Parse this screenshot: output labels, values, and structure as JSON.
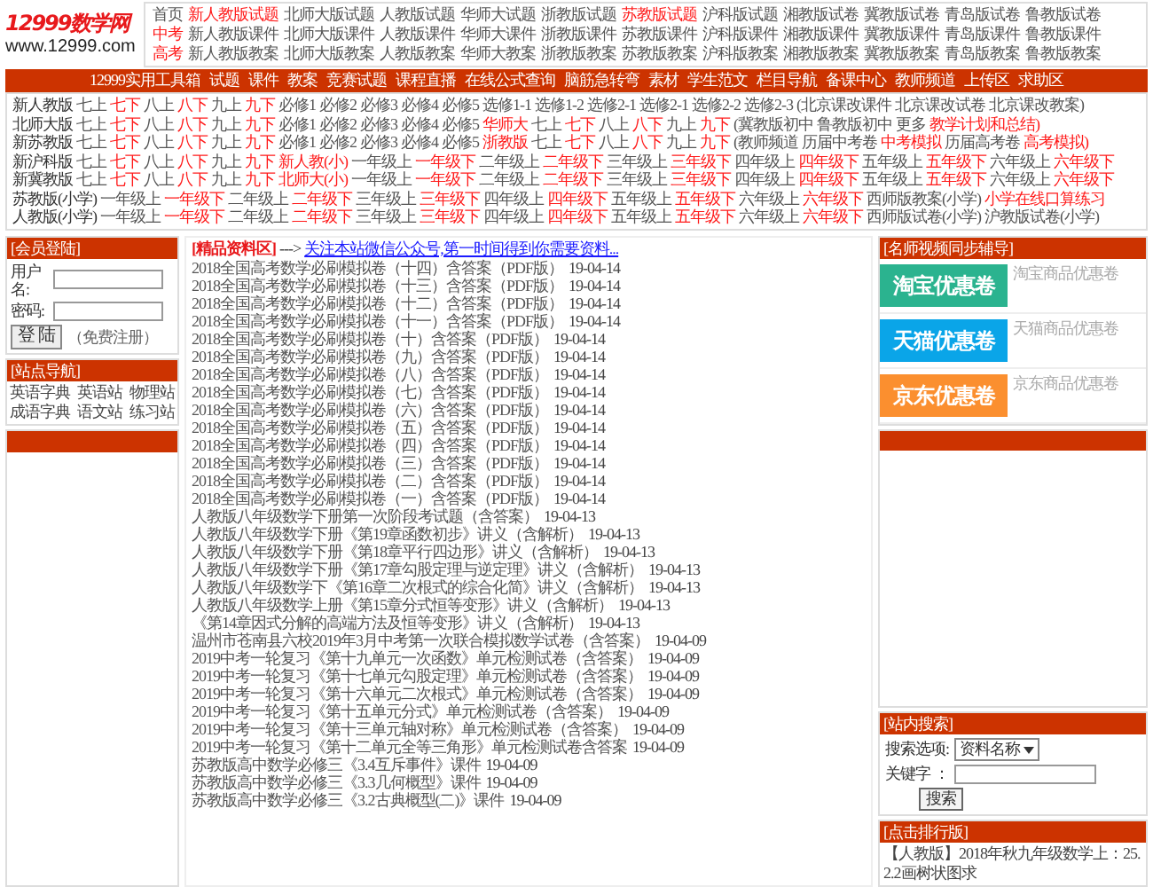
{
  "logo": {
    "name": "12999数学网",
    "url": "www.12999.com"
  },
  "header_rows": [
    [
      {
        "text": "首页",
        "highlight": false
      },
      {
        "text": "新人教版试题",
        "highlight": true
      },
      {
        "text": "北师大版试题",
        "highlight": false
      },
      {
        "text": "人教版试题",
        "highlight": false
      },
      {
        "text": "华师大试题",
        "highlight": false
      },
      {
        "text": "浙教版试题",
        "highlight": false
      },
      {
        "text": "苏教版试题",
        "highlight": true
      },
      {
        "text": "沪科版试题",
        "highlight": false
      },
      {
        "text": "湘教版试卷",
        "highlight": false
      },
      {
        "text": "冀教版试卷",
        "highlight": false
      },
      {
        "text": "青岛版试卷",
        "highlight": false
      },
      {
        "text": "鲁教版试卷",
        "highlight": false
      }
    ],
    [
      {
        "text": "中考",
        "highlight": true
      },
      {
        "text": "新人教版课件",
        "highlight": false
      },
      {
        "text": "北师大版课件",
        "highlight": false
      },
      {
        "text": "人教版课件",
        "highlight": false
      },
      {
        "text": "华师大课件",
        "highlight": false
      },
      {
        "text": "浙教版课件",
        "highlight": false
      },
      {
        "text": "苏教版课件",
        "highlight": false
      },
      {
        "text": "沪科版课件",
        "highlight": false
      },
      {
        "text": "湘教版课件",
        "highlight": false
      },
      {
        "text": "冀教版课件",
        "highlight": false
      },
      {
        "text": "青岛版课件",
        "highlight": false
      },
      {
        "text": "鲁教版课件",
        "highlight": false
      }
    ],
    [
      {
        "text": "高考",
        "highlight": true
      },
      {
        "text": "新人教版教案",
        "highlight": false
      },
      {
        "text": "北师大版教案",
        "highlight": false
      },
      {
        "text": "人教版教案",
        "highlight": false
      },
      {
        "text": "华师大教案",
        "highlight": false
      },
      {
        "text": "浙教版教案",
        "highlight": false
      },
      {
        "text": "苏教版教案",
        "highlight": false
      },
      {
        "text": "沪科版教案",
        "highlight": false
      },
      {
        "text": "湘教版教案",
        "highlight": false
      },
      {
        "text": "冀教版教案",
        "highlight": false
      },
      {
        "text": "青岛版教案",
        "highlight": false
      },
      {
        "text": "鲁教版教案",
        "highlight": false
      }
    ]
  ],
  "nav": [
    "12999实用工具箱",
    "试题",
    "课件",
    "教案",
    "竞赛试题",
    "课程直播",
    "在线公式查询",
    "脑筋急转弯",
    "素材",
    "学生范文",
    "栏目导航",
    "备课中心",
    "教师频道",
    "上传区",
    "求助区"
  ],
  "class_rows": [
    {
      "label": "新人教版",
      "links": [
        {
          "text": "七上",
          "highlight": false
        },
        {
          "text": "七下",
          "highlight": true
        },
        {
          "text": "八上",
          "highlight": false
        },
        {
          "text": "八下",
          "highlight": true
        },
        {
          "text": "九上",
          "highlight": false
        },
        {
          "text": "九下",
          "highlight": true
        },
        {
          "text": "必修1",
          "highlight": false
        },
        {
          "text": "必修2",
          "highlight": false
        },
        {
          "text": "必修3",
          "highlight": false
        },
        {
          "text": "必修4",
          "highlight": false
        },
        {
          "text": "必修5",
          "highlight": false
        },
        {
          "text": "选修1-1",
          "highlight": false
        },
        {
          "text": "选修1-2",
          "highlight": false
        },
        {
          "text": "选修2-1",
          "highlight": false
        },
        {
          "text": "选修2-1",
          "highlight": false
        },
        {
          "text": "选修2-2",
          "highlight": false
        },
        {
          "text": "选修2-3",
          "highlight": false
        },
        {
          "text": "(北京课改课件",
          "highlight": false
        },
        {
          "text": "北京课改试卷",
          "highlight": false
        },
        {
          "text": "北京课改教案)",
          "highlight": false
        }
      ]
    },
    {
      "label": "北师大版",
      "links": [
        {
          "text": "七上",
          "highlight": false
        },
        {
          "text": "七下",
          "highlight": true
        },
        {
          "text": "八上",
          "highlight": false
        },
        {
          "text": "八下",
          "highlight": true
        },
        {
          "text": "九上",
          "highlight": false
        },
        {
          "text": "九下",
          "highlight": true
        },
        {
          "text": "必修1",
          "highlight": false
        },
        {
          "text": "必修2",
          "highlight": false
        },
        {
          "text": "必修3",
          "highlight": false
        },
        {
          "text": "必修4",
          "highlight": false
        },
        {
          "text": "必修5",
          "highlight": false
        },
        {
          "text": "华师大",
          "highlight": true
        },
        {
          "text": "七上",
          "highlight": false
        },
        {
          "text": "七下",
          "highlight": true
        },
        {
          "text": "八上",
          "highlight": false
        },
        {
          "text": "八下",
          "highlight": true
        },
        {
          "text": "九上",
          "highlight": false
        },
        {
          "text": "九下",
          "highlight": true
        },
        {
          "text": "(冀教版初中",
          "highlight": false
        },
        {
          "text": "鲁教版初中",
          "highlight": false
        },
        {
          "text": "更多",
          "highlight": false
        },
        {
          "text": "教学计划和总结)",
          "highlight": true
        }
      ]
    },
    {
      "label": "新苏教版",
      "links": [
        {
          "text": "七上",
          "highlight": false
        },
        {
          "text": "七下",
          "highlight": true
        },
        {
          "text": "八上",
          "highlight": false
        },
        {
          "text": "八下",
          "highlight": true
        },
        {
          "text": "九上",
          "highlight": false
        },
        {
          "text": "九下",
          "highlight": true
        },
        {
          "text": "必修1",
          "highlight": false
        },
        {
          "text": "必修2",
          "highlight": false
        },
        {
          "text": "必修3",
          "highlight": false
        },
        {
          "text": "必修4",
          "highlight": false
        },
        {
          "text": "必修5",
          "highlight": false
        },
        {
          "text": "浙教版",
          "highlight": true
        },
        {
          "text": "七上",
          "highlight": false
        },
        {
          "text": "七下",
          "highlight": true
        },
        {
          "text": "八上",
          "highlight": false
        },
        {
          "text": "八下",
          "highlight": true
        },
        {
          "text": "九上",
          "highlight": false
        },
        {
          "text": "九下",
          "highlight": true
        },
        {
          "text": "(教师频道",
          "highlight": false
        },
        {
          "text": "历届中考卷",
          "highlight": false
        },
        {
          "text": "中考模拟",
          "highlight": true
        },
        {
          "text": "历届高考卷",
          "highlight": false
        },
        {
          "text": "高考模拟)",
          "highlight": true
        }
      ]
    },
    {
      "label": "新沪科版",
      "links": [
        {
          "text": "七上",
          "highlight": false
        },
        {
          "text": "七下",
          "highlight": true
        },
        {
          "text": "八上",
          "highlight": false
        },
        {
          "text": "八下",
          "highlight": true
        },
        {
          "text": "九上",
          "highlight": false
        },
        {
          "text": "九下",
          "highlight": true
        },
        {
          "text": "新人教(小)",
          "highlight": true
        },
        {
          "text": "一年级上",
          "highlight": false
        },
        {
          "text": "一年级下",
          "highlight": true
        },
        {
          "text": "二年级上",
          "highlight": false
        },
        {
          "text": "二年级下",
          "highlight": true
        },
        {
          "text": "三年级上",
          "highlight": false
        },
        {
          "text": "三年级下",
          "highlight": true
        },
        {
          "text": "四年级上",
          "highlight": false
        },
        {
          "text": "四年级下",
          "highlight": true
        },
        {
          "text": "五年级上",
          "highlight": false
        },
        {
          "text": "五年级下",
          "highlight": true
        },
        {
          "text": "六年级上",
          "highlight": false
        },
        {
          "text": "六年级下",
          "highlight": true
        }
      ]
    },
    {
      "label": "新冀教版",
      "links": [
        {
          "text": "七上",
          "highlight": false
        },
        {
          "text": "七下",
          "highlight": true
        },
        {
          "text": "八上",
          "highlight": false
        },
        {
          "text": "八下",
          "highlight": true
        },
        {
          "text": "九上",
          "highlight": false
        },
        {
          "text": "九下",
          "highlight": true
        },
        {
          "text": "北师大(小)",
          "highlight": true
        },
        {
          "text": "一年级上",
          "highlight": false
        },
        {
          "text": "一年级下",
          "highlight": true
        },
        {
          "text": "二年级上",
          "highlight": false
        },
        {
          "text": "二年级下",
          "highlight": true
        },
        {
          "text": "三年级上",
          "highlight": false
        },
        {
          "text": "三年级下",
          "highlight": true
        },
        {
          "text": "四年级上",
          "highlight": false
        },
        {
          "text": "四年级下",
          "highlight": true
        },
        {
          "text": "五年级上",
          "highlight": false
        },
        {
          "text": "五年级下",
          "highlight": true
        },
        {
          "text": "六年级上",
          "highlight": false
        },
        {
          "text": "六年级下",
          "highlight": true
        }
      ]
    },
    {
      "label": "苏教版(小学)",
      "links": [
        {
          "text": "一年级上",
          "highlight": false
        },
        {
          "text": "一年级下",
          "highlight": true
        },
        {
          "text": "二年级上",
          "highlight": false
        },
        {
          "text": "二年级下",
          "highlight": true
        },
        {
          "text": "三年级上",
          "highlight": false
        },
        {
          "text": "三年级下",
          "highlight": true
        },
        {
          "text": "四年级上",
          "highlight": false
        },
        {
          "text": "四年级下",
          "highlight": true
        },
        {
          "text": "五年级上",
          "highlight": false
        },
        {
          "text": "五年级下",
          "highlight": true
        },
        {
          "text": "六年级上",
          "highlight": false
        },
        {
          "text": "六年级下",
          "highlight": true
        },
        {
          "text": "西师版教案(小学)",
          "highlight": false
        },
        {
          "text": "小学在线口算练习",
          "highlight": true
        }
      ]
    },
    {
      "label": "人教版(小学)",
      "links": [
        {
          "text": "一年级上",
          "highlight": false
        },
        {
          "text": "一年级下",
          "highlight": true
        },
        {
          "text": "二年级上",
          "highlight": false
        },
        {
          "text": "二年级下",
          "highlight": true
        },
        {
          "text": "三年级上",
          "highlight": false
        },
        {
          "text": "三年级下",
          "highlight": true
        },
        {
          "text": "四年级上",
          "highlight": false
        },
        {
          "text": "四年级下",
          "highlight": true
        },
        {
          "text": "五年级上",
          "highlight": false
        },
        {
          "text": "五年级下",
          "highlight": true
        },
        {
          "text": "六年级上",
          "highlight": false
        },
        {
          "text": "六年级下",
          "highlight": true
        },
        {
          "text": "西师版试卷(小学)",
          "highlight": false
        },
        {
          "text": "沪教版试卷(小学)",
          "highlight": false
        }
      ]
    }
  ],
  "login": {
    "title": "[会员登陆]",
    "username_label": "用户名:",
    "password_label": "密码:",
    "button": "登 陆",
    "register": "（免费注册）"
  },
  "site_nav": {
    "title": "[站点导航]",
    "links": [
      "英语字典",
      "英语站",
      "物理站",
      "成语字典",
      "语文站",
      "练习站"
    ]
  },
  "featured": {
    "title": "[精品资料区]",
    "arrow": "--->",
    "link": "关注本站微信公众号,第一时间得到你需要资料..."
  },
  "articles": [
    {
      "title": "2018全国高考数学必刷模拟卷（十四）含答案（PDF版）",
      "date": "19-04-14"
    },
    {
      "title": "2018全国高考数学必刷模拟卷（十三）含答案（PDF版）",
      "date": "19-04-14"
    },
    {
      "title": "2018全国高考数学必刷模拟卷（十二）含答案（PDF版）",
      "date": "19-04-14"
    },
    {
      "title": "2018全国高考数学必刷模拟卷（十一）含答案（PDF版）",
      "date": "19-04-14"
    },
    {
      "title": "2018全国高考数学必刷模拟卷（十）含答案（PDF版）",
      "date": "19-04-14"
    },
    {
      "title": "2018全国高考数学必刷模拟卷（九）含答案（PDF版）",
      "date": "19-04-14"
    },
    {
      "title": "2018全国高考数学必刷模拟卷（八）含答案（PDF版）",
      "date": "19-04-14"
    },
    {
      "title": "2018全国高考数学必刷模拟卷（七）含答案（PDF版）",
      "date": "19-04-14"
    },
    {
      "title": "2018全国高考数学必刷模拟卷（六）含答案（PDF版）",
      "date": "19-04-14"
    },
    {
      "title": "2018全国高考数学必刷模拟卷（五）含答案（PDF版）",
      "date": "19-04-14"
    },
    {
      "title": "2018全国高考数学必刷模拟卷（四）含答案（PDF版）",
      "date": "19-04-14"
    },
    {
      "title": "2018全国高考数学必刷模拟卷（三）含答案（PDF版）",
      "date": "19-04-14"
    },
    {
      "title": "2018全国高考数学必刷模拟卷（二）含答案（PDF版）",
      "date": "19-04-14"
    },
    {
      "title": "2018全国高考数学必刷模拟卷（一）含答案（PDF版）",
      "date": "19-04-14"
    },
    {
      "title": "人教版八年级数学下册第一次阶段考试题（含答案）",
      "date": "19-04-13"
    },
    {
      "title": "人教版八年级数学下册《第19章函数初步》讲义（含解析）",
      "date": "19-04-13"
    },
    {
      "title": "人教版八年级数学下册《第18章平行四边形》讲义（含解析）",
      "date": "19-04-13"
    },
    {
      "title": "人教版八年级数学下册《第17章勾股定理与逆定理》讲义（含解析）",
      "date": "19-04-13"
    },
    {
      "title": "人教版八年级数学下《第16章二次根式的综合化简》讲义（含解析）",
      "date": "19-04-13"
    },
    {
      "title": "人教版八年级数学上册《第15章分式恒等变形》讲义（含解析）",
      "date": "19-04-13"
    },
    {
      "title": "《第14章因式分解的高端方法及恒等变形》讲义（含解析）",
      "date": "19-04-13"
    },
    {
      "title": "温州市苍南县六校2019年3月中考第一次联合模拟数学试卷（含答案）",
      "date": "19-04-09"
    },
    {
      "title": "2019中考一轮复习《第十九单元一次函数》单元检测试卷（含答案）",
      "date": "19-04-09"
    },
    {
      "title": "2019中考一轮复习《第十七单元勾股定理》单元检测试卷（含答案）",
      "date": "19-04-09"
    },
    {
      "title": "2019中考一轮复习《第十六单元二次根式》单元检测试卷（含答案）",
      "date": "19-04-09"
    },
    {
      "title": "2019中考一轮复习《第十五单元分式》单元检测试卷（含答案）",
      "date": "19-04-09"
    },
    {
      "title": "2019中考一轮复习《第十三单元轴对称》单元检测试卷（含答案）",
      "date": "19-04-09"
    },
    {
      "title": "2019中考一轮复习《第十二单元全等三角形》单元检测试卷含答案",
      "date": "19-04-09"
    },
    {
      "title": "苏教版高中数学必修三《3.4互斥事件》课件",
      "date": "19-04-09"
    },
    {
      "title": "苏教版高中数学必修三《3.3几何概型》课件",
      "date": "19-04-09"
    },
    {
      "title": "苏教版高中数学必修三《3.2古典概型(二)》课件",
      "date": "19-04-09"
    }
  ],
  "video_tutoring": {
    "title": "[名师视频同步辅导]",
    "coupons": [
      {
        "label": "淘宝优惠卷",
        "caption": "淘宝商品优惠卷",
        "color": "#2bb38f"
      },
      {
        "label": "天猫优惠卷",
        "caption": "天猫商品优惠卷",
        "color": "#0aa5e8"
      },
      {
        "label": "京东优惠卷",
        "caption": "京东商品优惠卷",
        "color": "#fb8f2f"
      }
    ]
  },
  "site_search": {
    "title": "[站内搜索]",
    "option_label": "搜索选项:",
    "option_value": "资料名称",
    "keyword_label": "关键字 ：",
    "button": "搜索"
  },
  "ranking": {
    "title": "[点击排行版]",
    "items": [
      "【人教版】2018年秋九年级数学上：25.2.2画树状图求"
    ]
  }
}
